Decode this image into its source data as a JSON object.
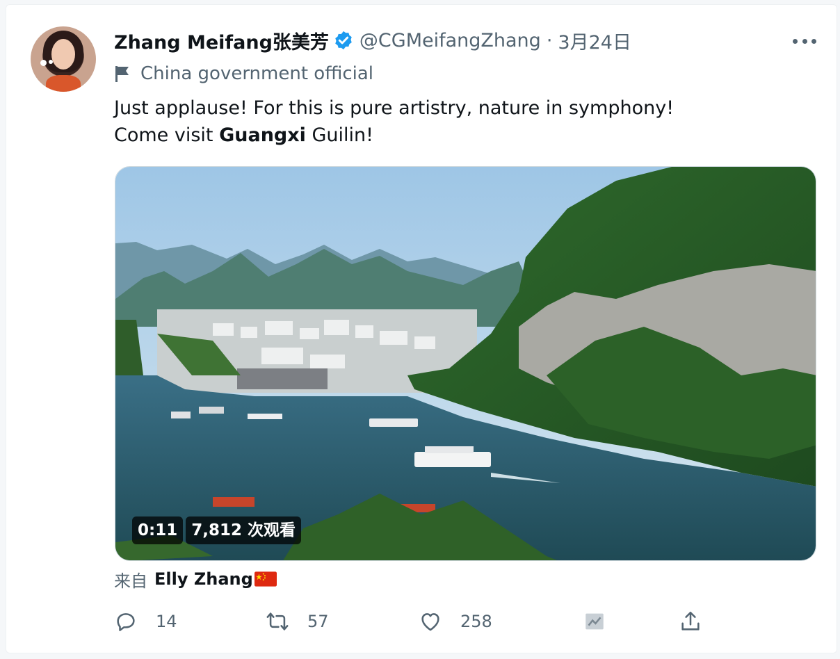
{
  "tweet": {
    "author_name": "Zhang Meifang张美芳",
    "handle": "@CGMeifangZhang",
    "separator": "·",
    "date": "3月24日",
    "label": "China government official",
    "text_line1": "Just applause! For this is pure artistry, nature in symphony!",
    "text_line2_prefix": "Come visit ",
    "text_line2_bold": "Guangxi",
    "text_line2_suffix": " Guilin!"
  },
  "video": {
    "duration": "0:11",
    "views": "7,812 次观看"
  },
  "from": {
    "prefix": "来自",
    "name": "Elly Zhang",
    "flag_icon": "china-flag-icon"
  },
  "actions": {
    "reply_count": "14",
    "retweet_count": "57",
    "like_count": "258"
  },
  "icons": {
    "verified": "verified-badge-icon",
    "label_flag": "flag-icon",
    "more": "more-dots-icon",
    "reply": "reply-icon",
    "retweet": "retweet-icon",
    "like": "heart-icon",
    "analytics": "analytics-icon",
    "share": "share-icon"
  },
  "colors": {
    "verified_blue": "#1d9bf0",
    "secondary_text": "#536471",
    "primary_text": "#0f1419"
  }
}
